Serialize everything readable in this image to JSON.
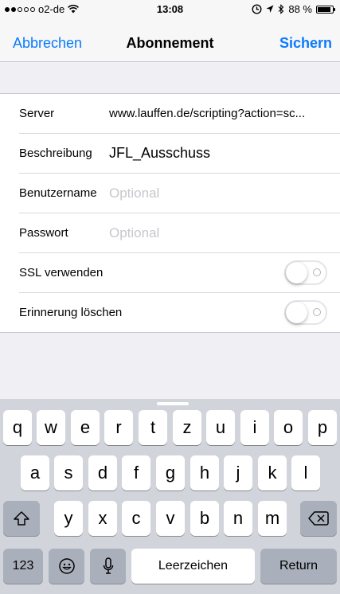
{
  "status_bar": {
    "carrier": "o2-de",
    "time": "13:08",
    "battery_percent": "88 %",
    "battery_level": 0.88,
    "signal_bars_filled": 2,
    "signal_bars_total": 5
  },
  "nav": {
    "cancel_label": "Abbrechen",
    "title": "Abonnement",
    "save_label": "Sichern"
  },
  "form": {
    "server": {
      "label": "Server",
      "value": "www.lauffen.de/scripting?action=sc..."
    },
    "description": {
      "label": "Beschreibung",
      "value": "JFL_Ausschuss"
    },
    "username": {
      "label": "Benutzername",
      "placeholder": "Optional"
    },
    "password": {
      "label": "Passwort",
      "placeholder": "Optional"
    },
    "ssl": {
      "label": "SSL verwenden",
      "on": false
    },
    "remove_alarms": {
      "label": "Erinnerung löschen",
      "on": false
    }
  },
  "keyboard": {
    "row1": [
      "q",
      "w",
      "e",
      "r",
      "t",
      "z",
      "u",
      "i",
      "o",
      "p"
    ],
    "row2": [
      "a",
      "s",
      "d",
      "f",
      "g",
      "h",
      "j",
      "k",
      "l"
    ],
    "row3": [
      "y",
      "x",
      "c",
      "v",
      "b",
      "n",
      "m"
    ],
    "numbers_label": "123",
    "space_label": "Leerzeichen",
    "return_label": "Return",
    "icons": {
      "shift": "shift-icon",
      "delete": "delete-icon",
      "emoji": "emoji-icon",
      "mic": "mic-icon"
    }
  },
  "colors": {
    "accent": "#0a7aff",
    "placeholder": "#c7c7cd",
    "keyboard_bg": "#d1d5db",
    "background": "#efeff4"
  }
}
